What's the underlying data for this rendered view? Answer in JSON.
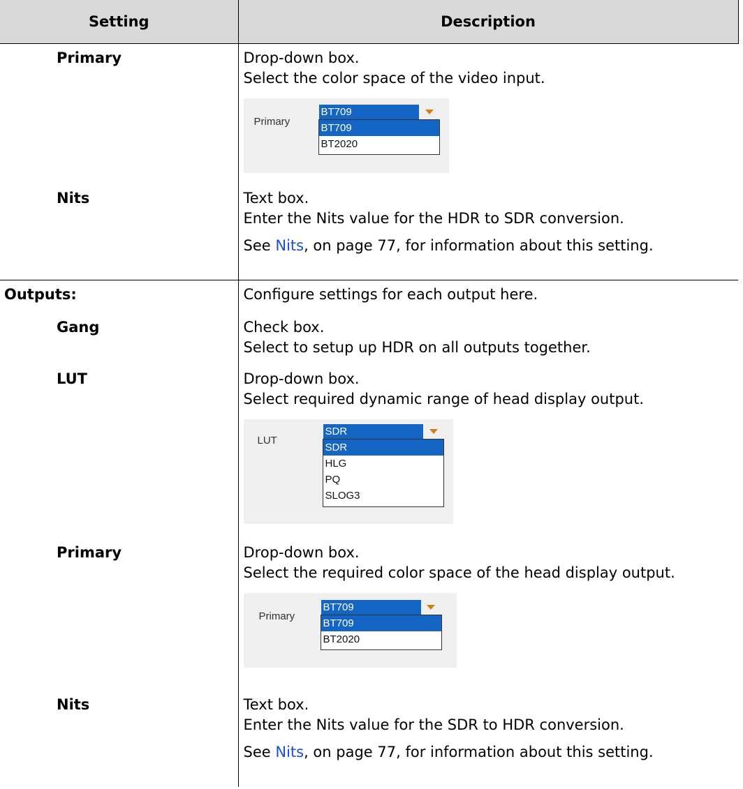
{
  "header": {
    "setting": "Setting",
    "description": "Description"
  },
  "rows": {
    "r1": {
      "setting": "Primary",
      "line1": "Drop-down box.",
      "line2": "Select the color space of the video input."
    },
    "r2": {
      "setting": "Nits",
      "line1": "Text box.",
      "line2": "Enter the Nits value for the HDR to SDR conversion.",
      "see_pre": "See ",
      "see_link": "Nits",
      "see_post": ", on page 77, for information about this setting."
    },
    "r3": {
      "setting": "Outputs:",
      "line1": "Configure settings for each output here."
    },
    "r4": {
      "setting": "Gang",
      "line1": "Check box.",
      "line2": "Select to setup up HDR on all outputs together."
    },
    "r5": {
      "setting": "LUT",
      "line1": "Drop-down box.",
      "line2": "Select required dynamic range of head display output."
    },
    "r6": {
      "setting": "Primary",
      "line1": "Drop-down box.",
      "line2": "Select the required color space of the head display output."
    },
    "r7": {
      "setting": "Nits",
      "line1": "Text box.",
      "line2": "Enter the Nits value for the SDR to HDR conversion.",
      "see_pre": "See ",
      "see_link": "Nits",
      "see_post": ", on page 77, for information about this setting."
    }
  },
  "shots": {
    "primary1": {
      "label": "Primary",
      "value": "BT709",
      "options": [
        "BT709",
        "BT2020"
      ]
    },
    "lut": {
      "label": "LUT",
      "value": "SDR",
      "options": [
        "SDR",
        "HLG",
        "PQ",
        "SLOG3"
      ]
    },
    "primary2": {
      "label": "Primary",
      "value": "BT709",
      "options": [
        "BT709",
        "BT2020"
      ]
    }
  },
  "colors": {
    "header_bg": "#d9d9d9",
    "link": "#1a4ed8",
    "combo_bg": "#1565c4",
    "arrow": "#d07e1a",
    "shot_bg": "#efefef"
  }
}
